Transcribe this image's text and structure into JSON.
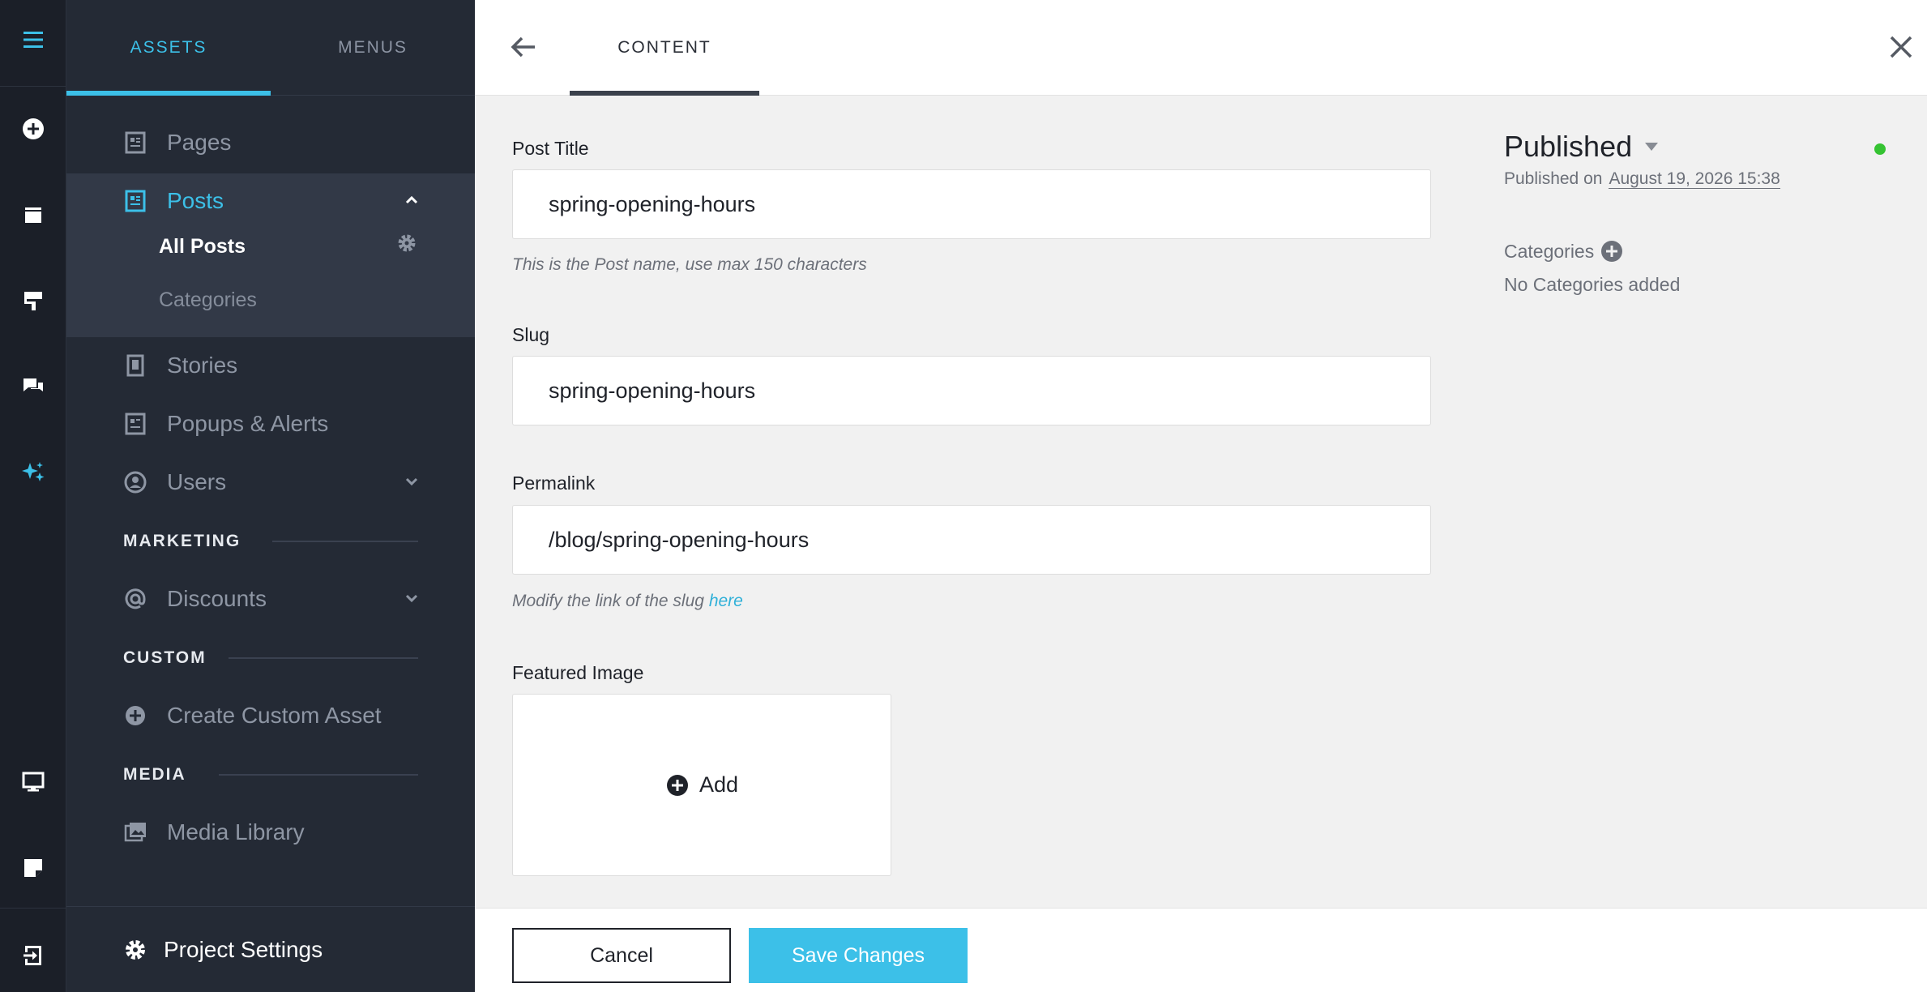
{
  "colors": {
    "accent": "#3cc0e8",
    "rail_bg": "#1b1f28",
    "nav_bg": "#242a35",
    "nav_group_bg": "#323947",
    "status_green": "#35c332"
  },
  "rail": {
    "icons": [
      "hamburger-menu-icon",
      "plus-circle-icon",
      "archive-icon",
      "paint-roller-icon",
      "chat-bubbles-icon",
      "sparkles-icon",
      "monitor-icon",
      "sticky-note-icon",
      "exit-icon"
    ]
  },
  "nav": {
    "tabs": [
      {
        "label": "ASSETS"
      },
      {
        "label": "MENUS"
      }
    ],
    "items": {
      "pages": "Pages",
      "posts": "Posts",
      "all_posts": "All Posts",
      "categories": "Categories",
      "stories": "Stories",
      "popups": "Popups & Alerts",
      "users": "Users",
      "discounts": "Discounts",
      "create_custom": "Create Custom Asset",
      "media_library": "Media Library"
    },
    "sections": {
      "marketing": "MARKETING",
      "custom": "CUSTOM",
      "media": "MEDIA"
    },
    "footer": "Project Settings"
  },
  "header": {
    "tab": "CONTENT"
  },
  "form": {
    "post_title": {
      "label": "Post Title",
      "value": "spring-opening-hours",
      "hint": "This is the Post name, use max 150 characters"
    },
    "slug": {
      "label": "Slug",
      "value": "spring-opening-hours"
    },
    "permalink": {
      "label": "Permalink",
      "value": "/blog/spring-opening-hours",
      "hint_prefix": "Modify the link of the slug",
      "hint_link": "here"
    },
    "featured_image": {
      "label": "Featured Image",
      "add_label": "Add"
    }
  },
  "status": {
    "title": "Published",
    "published_on_label": "Published on",
    "published_on_date": "August 19, 2026 15:38",
    "categories_label": "Categories",
    "categories_empty": "No Categories added"
  },
  "actions": {
    "cancel": "Cancel",
    "save": "Save Changes"
  }
}
